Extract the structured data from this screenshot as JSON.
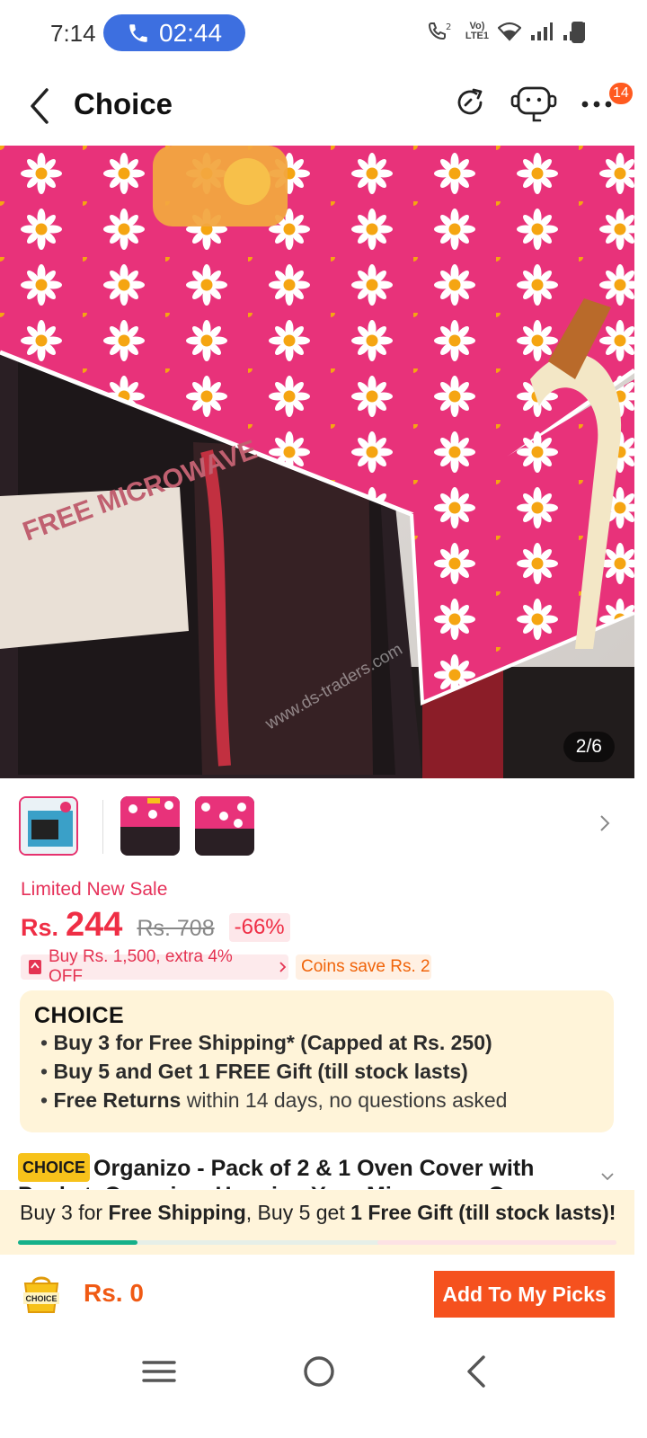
{
  "status_bar": {
    "time": "7:14",
    "call_timer": "02:44",
    "network_label_top": "Vo)",
    "network_label_bottom": "LTE1",
    "call_sim": "2"
  },
  "header": {
    "title": "Choice",
    "badge_count": "14"
  },
  "gallery": {
    "pager": "2/6",
    "watermark": "www.ds-traders.com",
    "overlay_text": "FREE MICROWAVE",
    "thumbnail_count": 3,
    "selected_thumbnail": 0
  },
  "price": {
    "sale_label": "Limited New Sale",
    "currency": "Rs.",
    "amount": "244",
    "original": "Rs. 708",
    "discount": "-66%"
  },
  "promos": {
    "deal": "Buy Rs. 1,500, extra 4% OFF",
    "coins": "Coins save Rs. 2"
  },
  "choice_box": {
    "logo": "CHOICE",
    "line1_bold": "Buy 3 for  Free Shipping* (Capped at Rs. 250)",
    "line2_bold": "Buy 5 and Get 1 FREE Gift (till stock lasts)",
    "line3_bold": "Free Returns",
    "line3_rest": " within 14 days, no questions asked"
  },
  "product": {
    "tag": "CHOICE",
    "title": "Organizo - Pack of 2 & 1 Oven Cover with Pocket, Organizer Hanging Your Microwave Oven"
  },
  "shipping_banner": {
    "part1": "Buy 3 for ",
    "part2": "Free Shipping",
    "part3": ", Buy 5 get ",
    "part4": "1 Free Gift (till stock lasts)!",
    "progress": 0.2
  },
  "bottom_bar": {
    "cart_label": "CHOICE",
    "total": "Rs. 0",
    "add_button": "Add To My Picks"
  },
  "colors": {
    "accent": "#f5511e",
    "price": "#ef2e45",
    "choice_bg": "#fff4d9",
    "call_pill": "#3d6fe0"
  }
}
